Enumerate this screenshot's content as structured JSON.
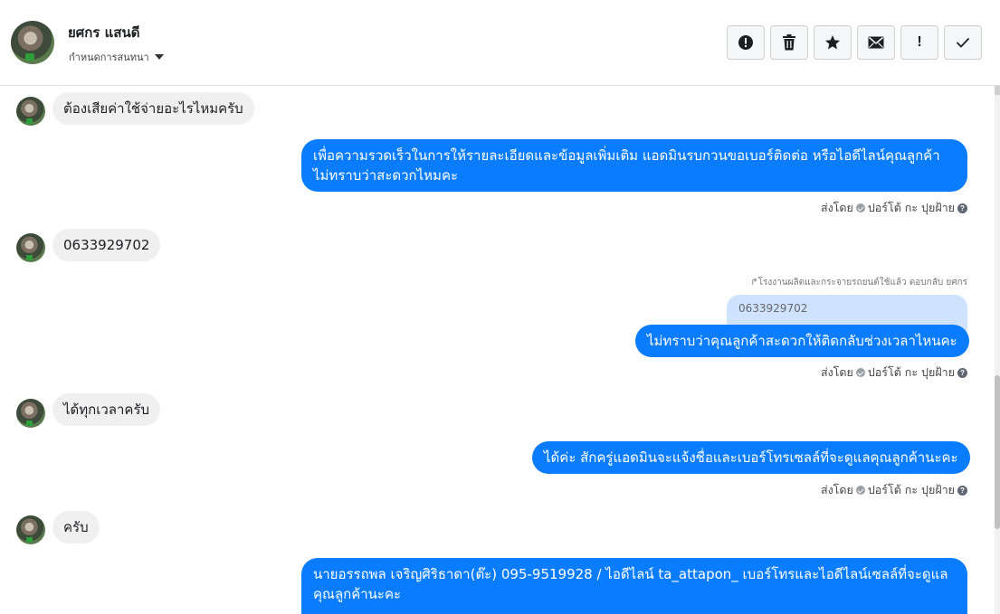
{
  "header": {
    "contact_name": "ยศกร แสนดี",
    "assign_label": "กำหนดการสนทนา",
    "actions": [
      {
        "name": "report-button",
        "icon": "exclamation-circle-icon"
      },
      {
        "name": "delete-button",
        "icon": "trash-icon"
      },
      {
        "name": "star-button",
        "icon": "star-icon"
      },
      {
        "name": "mark-unread-button",
        "icon": "envelope-icon"
      },
      {
        "name": "follow-up-button",
        "icon": "exclamation-icon",
        "text": "!"
      },
      {
        "name": "done-button",
        "icon": "checkmark-icon"
      }
    ]
  },
  "messages": [
    {
      "from": "customer",
      "text": "ต้องเสียค่าใช้จ่ายอะไรไหมครับ"
    },
    {
      "from": "page",
      "text": "เพื่อความรวดเร็วในการให้รายละเอียดและข้อมูลเพิ่มเติม แอดมินรบกวนขอเบอร์ติดต่อ หรือไอดีไลน์คุณลูกค้า ไม่ทราบว่าสะดวกไหมคะ",
      "sent_by_label": "ส่งโดย",
      "sender": "ปอร์โต้ กะ ปุยฝ้าย"
    },
    {
      "from": "customer",
      "text": "0633929702"
    },
    {
      "from": "page",
      "reply_note": "โรงงานผลิตและกระจายรถยนต์ใช้แล้ว ตอบกลับ ยศกร",
      "quoted": "0633929702",
      "text": "ไม่ทราบว่าคุณลูกค้าสะดวกให้ติดกลับช่วงเวลาไหนคะ",
      "sent_by_label": "ส่งโดย",
      "sender": "ปอร์โต้ กะ ปุยฝ้าย"
    },
    {
      "from": "customer",
      "text": "ได้ทุกเวลาครับ"
    },
    {
      "from": "page",
      "text": "ได้ค่ะ สักครู่แอดมินจะแจ้งชื่อและเบอร์โทรเซลล์ที่จะดูแลคุณลูกค้านะคะ",
      "sent_by_label": "ส่งโดย",
      "sender": "ปอร์โต้ กะ ปุยฝ้าย"
    },
    {
      "from": "customer",
      "text": "ครับ"
    },
    {
      "from": "page",
      "text": "นายอรรถพล เจริญศิริธาดา(ต๊ะ)      095-9519928 / ไอดีไลน์ ta_attapon_  เบอร์โทรและไอดีไลน์เซลล์ที่จะดูแลคุณลูกค้านะคะ"
    }
  ],
  "colors": {
    "outgoing_bubble": "#0a7cff",
    "incoming_bubble": "#f0f0f0",
    "quoted_bubble": "#cfe3ff"
  }
}
